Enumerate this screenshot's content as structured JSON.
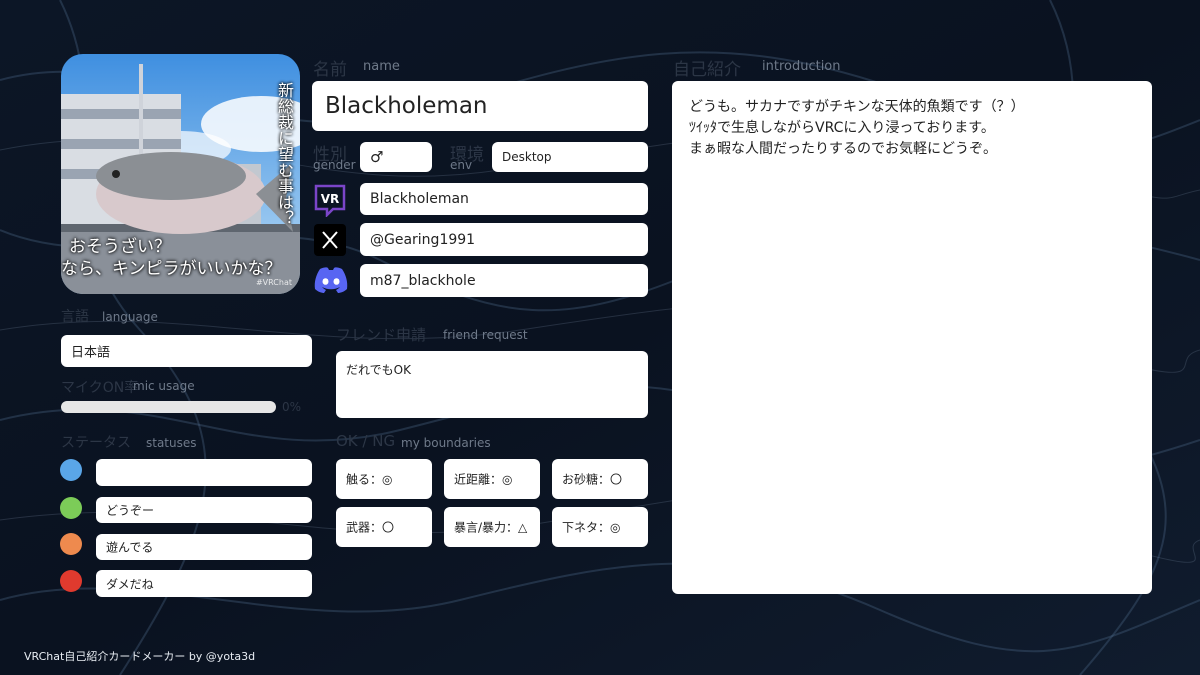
{
  "avatar": {
    "caption_vertical": "新総裁に望む事は？",
    "caption_line1": "おそうざい？",
    "caption_line2": "なら、キンピラがいいかな？",
    "watermark": "#VRChat"
  },
  "name": {
    "label_ja": "名前",
    "label_en": "name",
    "value": "Blackholeman"
  },
  "gender": {
    "label_ja": "性別",
    "label_en": "gender",
    "value": "♂"
  },
  "env": {
    "label_ja": "環境",
    "label_en": "env",
    "value": "Desktop"
  },
  "vrchat": {
    "icon_text": "VR",
    "value": "Blackholeman"
  },
  "x": {
    "value": "@Gearing1991"
  },
  "discord": {
    "value": "m87_blackhole"
  },
  "language": {
    "label_ja": "言語",
    "label_en": "language",
    "value": "日本語"
  },
  "mic": {
    "label_ja": "マイクON率",
    "label_en": "mic usage",
    "percent_text": "0%",
    "level": 0
  },
  "statuses": {
    "label_ja": "ステータス",
    "label_en": "statuses",
    "items": [
      {
        "color": "#5aa6e8",
        "text": ""
      },
      {
        "color": "#7ccc58",
        "text": "どうぞー"
      },
      {
        "color": "#ee8a4e",
        "text": "遊んでる"
      },
      {
        "color": "#e03a2e",
        "text": "ダメだね"
      }
    ]
  },
  "friend_request": {
    "label_ja": "フレンド申請",
    "label_en": "friend request",
    "value": "だれでもOK"
  },
  "boundaries": {
    "label_ja": "OK / NG",
    "label_en": "my boundaries",
    "items": [
      "触る：◎",
      "近距離：◎",
      "お砂糖：〇",
      "武器：〇",
      "暴言/暴力：△",
      "下ネタ：◎"
    ]
  },
  "introduction": {
    "label_ja": "自己紹介",
    "label_en": "introduction",
    "line1": "どうも。サカナですがチキンな天体的魚類です（？）",
    "line2": "ﾂｲｯﾀで生息しながらVRCに入り浸っております。",
    "line3": "まぁ暇な人間だったりするのでお気軽にどうぞ。"
  },
  "footer": {
    "credit": "VRChat自己紹介カードメーカー by @yota3d"
  }
}
